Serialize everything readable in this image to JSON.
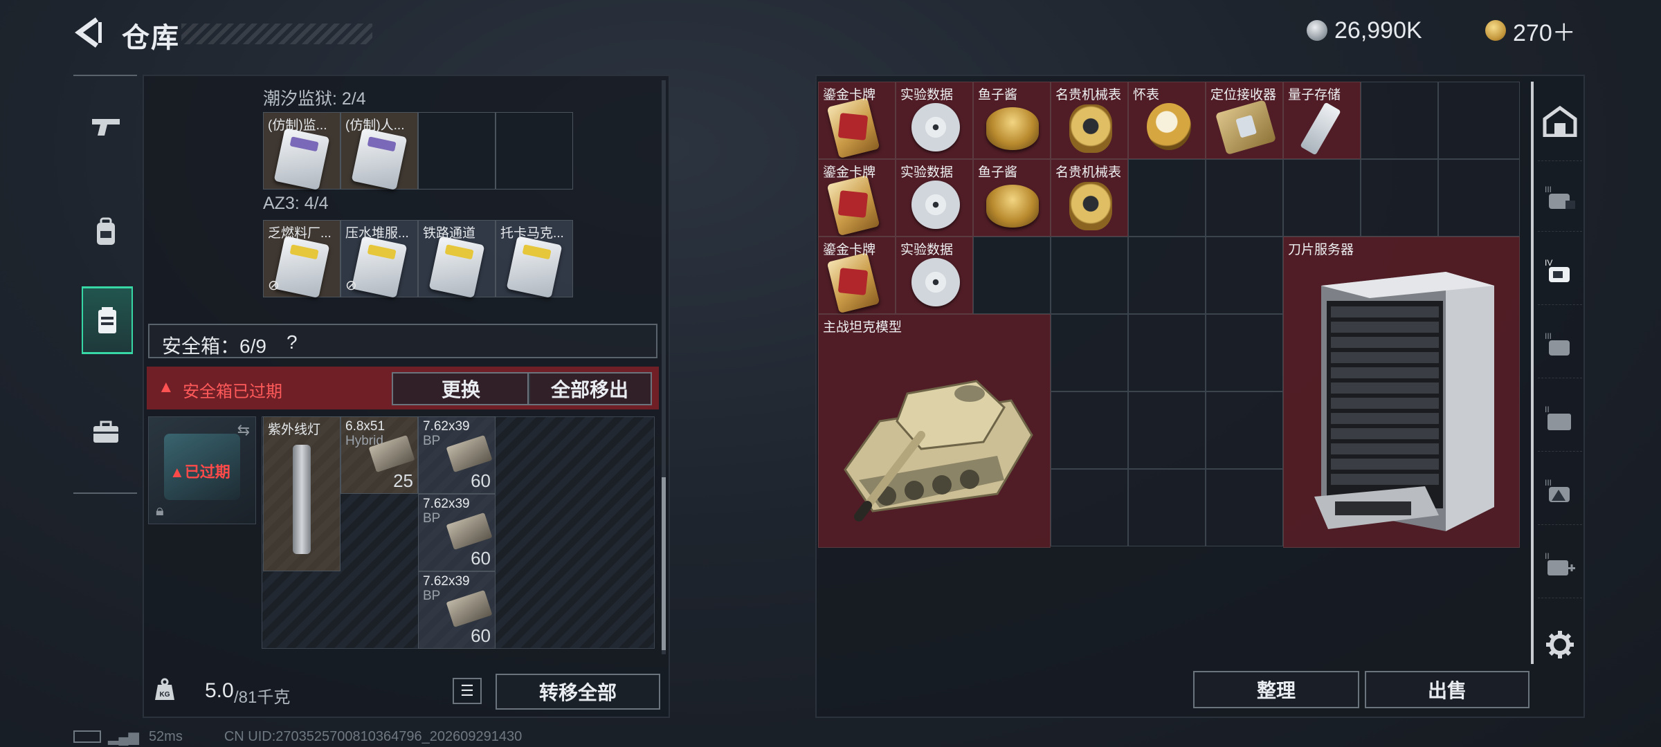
{
  "header": {
    "title": "仓库"
  },
  "currency": {
    "silver": "26,990K",
    "gold": "270＋"
  },
  "sidebar": {
    "items": [
      "weapon",
      "backpack",
      "safebox",
      "toolbox"
    ]
  },
  "left": {
    "section1": {
      "label": "潮汐监狱: 2/4",
      "items": [
        "(仿制)监...",
        "(仿制)人..."
      ]
    },
    "section2": {
      "label": "AZ3: 4/4",
      "items": [
        "乏燃料厂...",
        "压水堆服...",
        "铁路通道",
        "托卡马克..."
      ]
    },
    "safebox_label": "安全箱：6/9",
    "help_mark": "?",
    "expired_notice": "安全箱已过期",
    "replace_button": "更换",
    "move_all_button": "全部移出",
    "safe_expired_tag": "已过期",
    "slots": [
      {
        "name": "紫外线灯",
        "sub": ""
      },
      {
        "name": "6.8x51",
        "sub": "Hybrid",
        "count": "25"
      },
      {
        "name": "7.62x39",
        "sub": "BP",
        "count": "60"
      },
      {
        "name": "7.62x39",
        "sub": "BP",
        "count": "60"
      },
      {
        "name": "7.62x39",
        "sub": "BP",
        "count": "60"
      }
    ],
    "weight_current": "5.0",
    "weight_total": "/81千克",
    "transfer_all_button": "转移全部"
  },
  "right": {
    "row1": [
      "鎏金卡牌",
      "实验数据",
      "鱼子酱",
      "名贵机械表",
      "怀表",
      "定位接收器",
      "量子存储"
    ],
    "row2": [
      "鎏金卡牌",
      "实验数据",
      "鱼子酱",
      "名贵机械表"
    ],
    "row3": [
      "鎏金卡牌",
      "实验数据"
    ],
    "server_label": "刀片服务器",
    "tank_label": "主战坦克模型",
    "sort_button": "整理",
    "sell_button": "出售"
  },
  "status": {
    "ping": "52ms",
    "uid": "CN UID:2703525700810364796_202609291430"
  },
  "colors": {
    "accent": "#37d8a6",
    "expired_red": "#ff4a4a",
    "item_bg": "#601e26"
  }
}
